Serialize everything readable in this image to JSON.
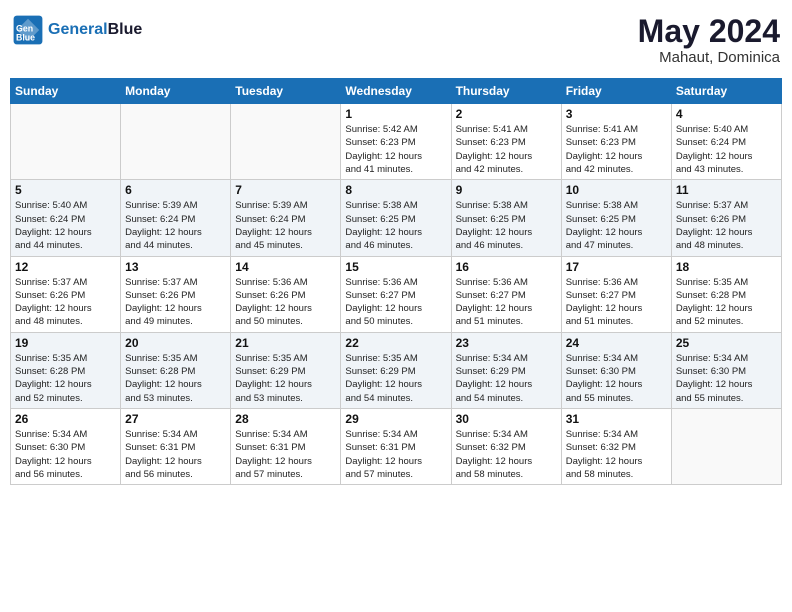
{
  "header": {
    "logo_line1": "General",
    "logo_line2": "Blue",
    "month": "May 2024",
    "location": "Mahaut, Dominica"
  },
  "days_of_week": [
    "Sunday",
    "Monday",
    "Tuesday",
    "Wednesday",
    "Thursday",
    "Friday",
    "Saturday"
  ],
  "weeks": [
    {
      "days": [
        {
          "number": "",
          "info": ""
        },
        {
          "number": "",
          "info": ""
        },
        {
          "number": "",
          "info": ""
        },
        {
          "number": "1",
          "info": "Sunrise: 5:42 AM\nSunset: 6:23 PM\nDaylight: 12 hours\nand 41 minutes."
        },
        {
          "number": "2",
          "info": "Sunrise: 5:41 AM\nSunset: 6:23 PM\nDaylight: 12 hours\nand 42 minutes."
        },
        {
          "number": "3",
          "info": "Sunrise: 5:41 AM\nSunset: 6:23 PM\nDaylight: 12 hours\nand 42 minutes."
        },
        {
          "number": "4",
          "info": "Sunrise: 5:40 AM\nSunset: 6:24 PM\nDaylight: 12 hours\nand 43 minutes."
        }
      ]
    },
    {
      "days": [
        {
          "number": "5",
          "info": "Sunrise: 5:40 AM\nSunset: 6:24 PM\nDaylight: 12 hours\nand 44 minutes."
        },
        {
          "number": "6",
          "info": "Sunrise: 5:39 AM\nSunset: 6:24 PM\nDaylight: 12 hours\nand 44 minutes."
        },
        {
          "number": "7",
          "info": "Sunrise: 5:39 AM\nSunset: 6:24 PM\nDaylight: 12 hours\nand 45 minutes."
        },
        {
          "number": "8",
          "info": "Sunrise: 5:38 AM\nSunset: 6:25 PM\nDaylight: 12 hours\nand 46 minutes."
        },
        {
          "number": "9",
          "info": "Sunrise: 5:38 AM\nSunset: 6:25 PM\nDaylight: 12 hours\nand 46 minutes."
        },
        {
          "number": "10",
          "info": "Sunrise: 5:38 AM\nSunset: 6:25 PM\nDaylight: 12 hours\nand 47 minutes."
        },
        {
          "number": "11",
          "info": "Sunrise: 5:37 AM\nSunset: 6:26 PM\nDaylight: 12 hours\nand 48 minutes."
        }
      ]
    },
    {
      "days": [
        {
          "number": "12",
          "info": "Sunrise: 5:37 AM\nSunset: 6:26 PM\nDaylight: 12 hours\nand 48 minutes."
        },
        {
          "number": "13",
          "info": "Sunrise: 5:37 AM\nSunset: 6:26 PM\nDaylight: 12 hours\nand 49 minutes."
        },
        {
          "number": "14",
          "info": "Sunrise: 5:36 AM\nSunset: 6:26 PM\nDaylight: 12 hours\nand 50 minutes."
        },
        {
          "number": "15",
          "info": "Sunrise: 5:36 AM\nSunset: 6:27 PM\nDaylight: 12 hours\nand 50 minutes."
        },
        {
          "number": "16",
          "info": "Sunrise: 5:36 AM\nSunset: 6:27 PM\nDaylight: 12 hours\nand 51 minutes."
        },
        {
          "number": "17",
          "info": "Sunrise: 5:36 AM\nSunset: 6:27 PM\nDaylight: 12 hours\nand 51 minutes."
        },
        {
          "number": "18",
          "info": "Sunrise: 5:35 AM\nSunset: 6:28 PM\nDaylight: 12 hours\nand 52 minutes."
        }
      ]
    },
    {
      "days": [
        {
          "number": "19",
          "info": "Sunrise: 5:35 AM\nSunset: 6:28 PM\nDaylight: 12 hours\nand 52 minutes."
        },
        {
          "number": "20",
          "info": "Sunrise: 5:35 AM\nSunset: 6:28 PM\nDaylight: 12 hours\nand 53 minutes."
        },
        {
          "number": "21",
          "info": "Sunrise: 5:35 AM\nSunset: 6:29 PM\nDaylight: 12 hours\nand 53 minutes."
        },
        {
          "number": "22",
          "info": "Sunrise: 5:35 AM\nSunset: 6:29 PM\nDaylight: 12 hours\nand 54 minutes."
        },
        {
          "number": "23",
          "info": "Sunrise: 5:34 AM\nSunset: 6:29 PM\nDaylight: 12 hours\nand 54 minutes."
        },
        {
          "number": "24",
          "info": "Sunrise: 5:34 AM\nSunset: 6:30 PM\nDaylight: 12 hours\nand 55 minutes."
        },
        {
          "number": "25",
          "info": "Sunrise: 5:34 AM\nSunset: 6:30 PM\nDaylight: 12 hours\nand 55 minutes."
        }
      ]
    },
    {
      "days": [
        {
          "number": "26",
          "info": "Sunrise: 5:34 AM\nSunset: 6:30 PM\nDaylight: 12 hours\nand 56 minutes."
        },
        {
          "number": "27",
          "info": "Sunrise: 5:34 AM\nSunset: 6:31 PM\nDaylight: 12 hours\nand 56 minutes."
        },
        {
          "number": "28",
          "info": "Sunrise: 5:34 AM\nSunset: 6:31 PM\nDaylight: 12 hours\nand 57 minutes."
        },
        {
          "number": "29",
          "info": "Sunrise: 5:34 AM\nSunset: 6:31 PM\nDaylight: 12 hours\nand 57 minutes."
        },
        {
          "number": "30",
          "info": "Sunrise: 5:34 AM\nSunset: 6:32 PM\nDaylight: 12 hours\nand 58 minutes."
        },
        {
          "number": "31",
          "info": "Sunrise: 5:34 AM\nSunset: 6:32 PM\nDaylight: 12 hours\nand 58 minutes."
        },
        {
          "number": "",
          "info": ""
        }
      ]
    }
  ]
}
